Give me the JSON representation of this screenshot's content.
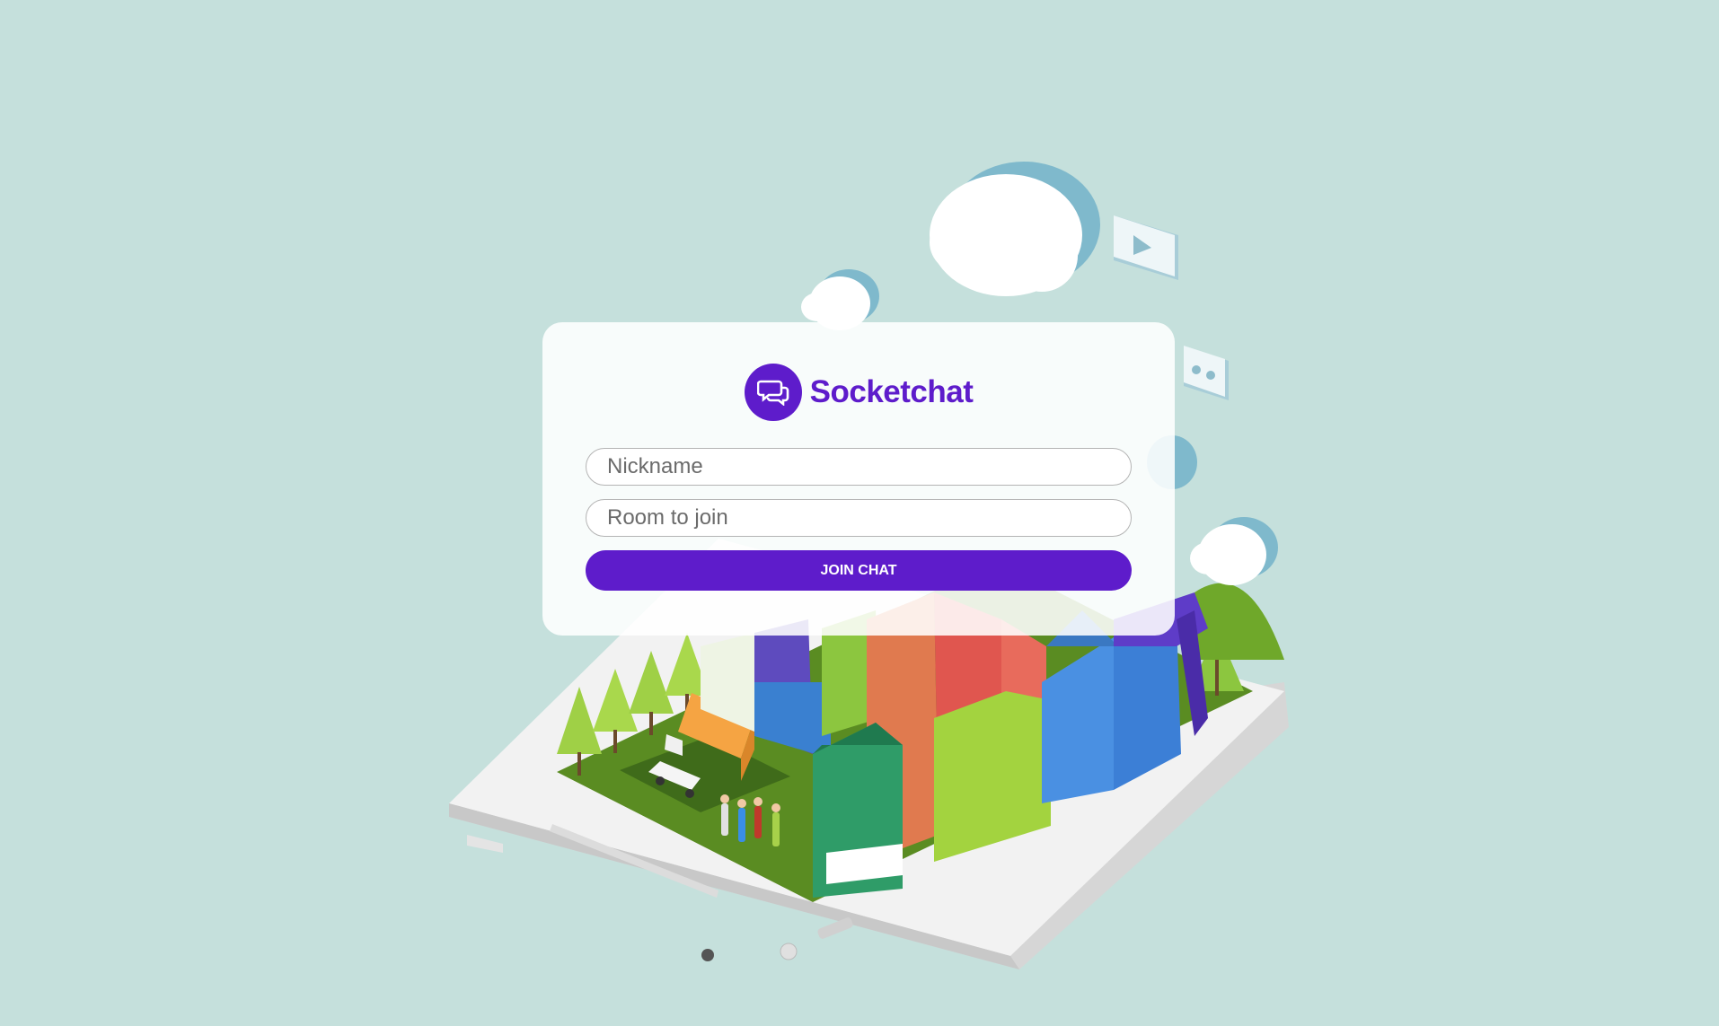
{
  "app": {
    "name": "Socketchat",
    "logo_icon": "chat-bubbles-icon",
    "brand_color": "#5e1ccb",
    "background_color": "#c5e0dc"
  },
  "form": {
    "nickname_placeholder": "Nickname",
    "nickname_value": "",
    "room_placeholder": "Room to join",
    "room_value": "",
    "join_label": "JOIN CHAT"
  },
  "illustration": {
    "subject": "isometric-city-on-smartphone",
    "icons": [
      "cloud-icon",
      "play-video-icon",
      "cassette-icon"
    ]
  }
}
